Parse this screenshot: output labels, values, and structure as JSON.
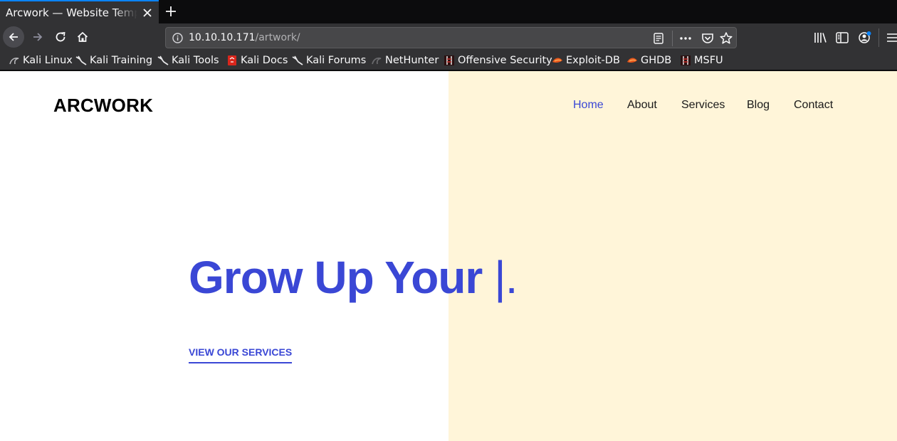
{
  "browser": {
    "tab": {
      "title": "Arcwork — Website Template"
    },
    "url": {
      "host": "10.10.10.171",
      "path": "/artwork/"
    },
    "bookmarks": [
      {
        "label": "Kali Linux",
        "icon": "kali-dragon-icon"
      },
      {
        "label": "Kali Training",
        "icon": "kali-dragon-icon"
      },
      {
        "label": "Kali Tools",
        "icon": "kali-dragon-icon"
      },
      {
        "label": "Kali Docs",
        "icon": "kali-docs-icon"
      },
      {
        "label": "Kali Forums",
        "icon": "kali-dragon-icon"
      },
      {
        "label": "NetHunter",
        "icon": "nethunter-icon"
      },
      {
        "label": "Offensive Security",
        "icon": "offsec-icon"
      },
      {
        "label": "Exploit-DB",
        "icon": "exploit-db-icon"
      },
      {
        "label": "GHDB",
        "icon": "exploit-db-icon"
      },
      {
        "label": "MSFU",
        "icon": "offsec-icon"
      }
    ],
    "accent_color": "#0a84ff"
  },
  "site": {
    "logo": "ARCWORK",
    "nav": [
      {
        "label": "Home",
        "active": true
      },
      {
        "label": "About",
        "active": false
      },
      {
        "label": "Services",
        "active": false
      },
      {
        "label": "Blog",
        "active": false
      },
      {
        "label": "Contact",
        "active": false
      }
    ],
    "hero": {
      "title": "Grow Up Your ",
      "cursor": "|.",
      "cta": "VIEW OUR SERVICES"
    },
    "colors": {
      "brand": "#3a47d5",
      "hero_panel": "#fff5d9"
    }
  }
}
